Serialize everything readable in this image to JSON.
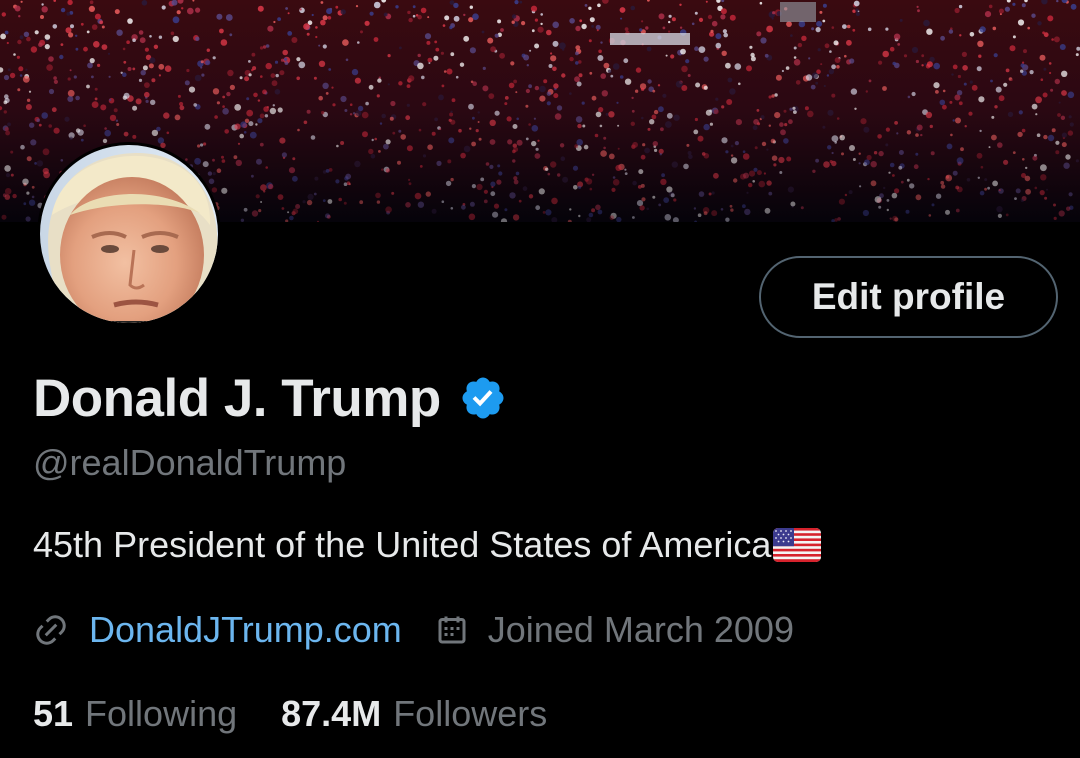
{
  "profile": {
    "display_name": "Donald J. Trump",
    "handle": "@realDonaldTrump",
    "bio": "45th President of the United States of America",
    "bio_emoji": "us-flag",
    "website": "DonaldJTrump.com",
    "joined": "Joined March 2009",
    "verified": true
  },
  "actions": {
    "edit_profile_label": "Edit profile"
  },
  "stats": {
    "following_count": "51",
    "following_label": "Following",
    "followers_count": "87.4M",
    "followers_label": "Followers"
  },
  "icons": {
    "verified": "verified-badge-icon",
    "link": "link-icon",
    "calendar": "calendar-icon"
  },
  "colors": {
    "background": "#000000",
    "primary_text": "#e7e9ea",
    "secondary_text": "#71767b",
    "link": "#6cb6ef",
    "verified": "#1d9bf0",
    "button_border": "#536471"
  }
}
